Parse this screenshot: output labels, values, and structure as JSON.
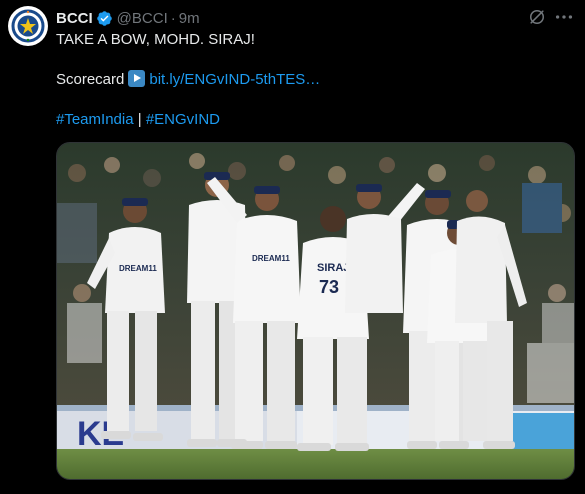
{
  "tweet": {
    "display_name": "BCCI",
    "handle": "@BCCI",
    "separator": "·",
    "time": "9m",
    "line1": "TAKE A BOW, MOHD. SIRAJ!",
    "scorecard_label": "Scorecard",
    "link_text": "bit.ly/ENGvIND-5thTES…",
    "hashtag1": "#TeamIndia",
    "divider": "|",
    "hashtag2": "#ENGvIND"
  },
  "photo": {
    "jersey_sponsor": "DREAM11",
    "back_name": "SIRAJ",
    "back_number": "73",
    "board_text": "KE"
  },
  "colors": {
    "link": "#1d9bf0",
    "verified": "#1d9bf0",
    "muted": "#71767b",
    "text": "#e7e9ea"
  }
}
